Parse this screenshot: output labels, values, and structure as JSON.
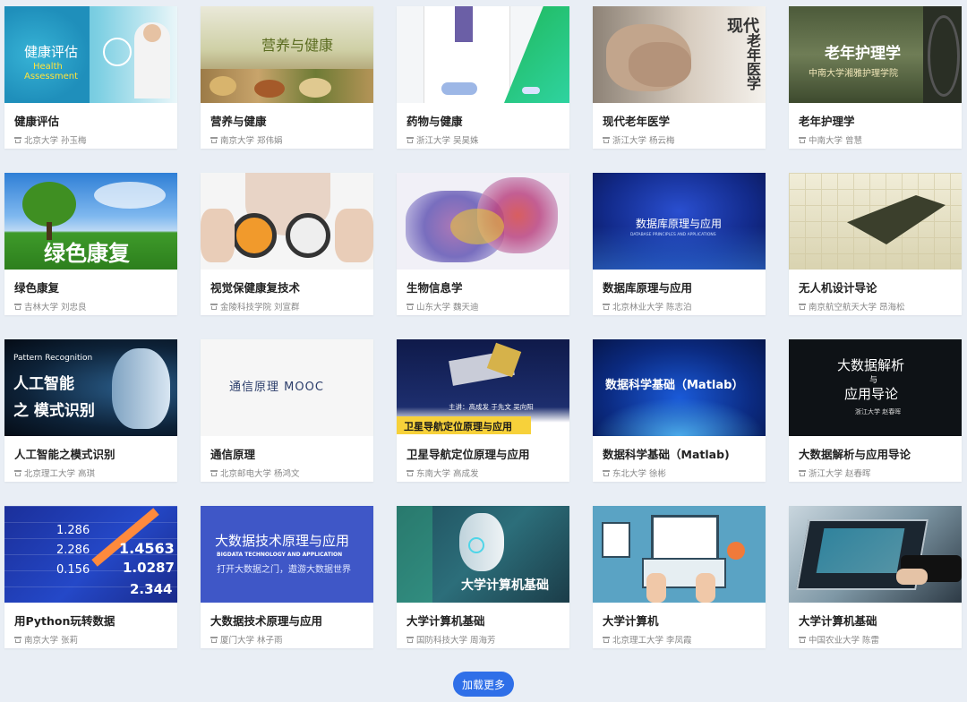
{
  "courses": [
    {
      "title": "健康评估",
      "school": "北京大学",
      "teacher": "孙玉梅",
      "cover_texts": [
        "健康评估",
        "Health",
        "Assessment"
      ]
    },
    {
      "title": "营养与健康",
      "school": "南京大学",
      "teacher": "郑伟娟",
      "cover_texts": [
        "营养与健康"
      ]
    },
    {
      "title": "药物与健康",
      "school": "浙江大学",
      "teacher": "吴昊姝",
      "cover_texts": []
    },
    {
      "title": "现代老年医学",
      "school": "浙江大学",
      "teacher": "杨云梅",
      "cover_texts": [
        "现代",
        "老年医学"
      ]
    },
    {
      "title": "老年护理学",
      "school": "中南大学",
      "teacher": "曾慧",
      "cover_texts": [
        "老年护理学",
        "中南大学湘雅护理学院"
      ]
    },
    {
      "title": "绿色康复",
      "school": "吉林大学",
      "teacher": "刘忠良",
      "cover_texts": [
        "绿色康复"
      ]
    },
    {
      "title": "视觉保健康复技术",
      "school": "金陵科技学院",
      "teacher": "刘宣群",
      "cover_texts": []
    },
    {
      "title": "生物信息学",
      "school": "山东大学",
      "teacher": "魏天迪",
      "cover_texts": []
    },
    {
      "title": "数据库原理与应用",
      "school": "北京林业大学",
      "teacher": "陈志泊",
      "cover_texts": [
        "数据库原理与应用",
        "DATABASE PRINCIPLES AND APPLICATIONS"
      ]
    },
    {
      "title": "无人机设计导论",
      "school": "南京航空航天大学",
      "teacher": "昂海松",
      "cover_texts": []
    },
    {
      "title": "人工智能之模式识别",
      "school": "北京理工大学",
      "teacher": "高琪",
      "cover_texts": [
        "Pattern Recognition",
        "人工智能",
        "之 模式识别"
      ]
    },
    {
      "title": "通信原理",
      "school": "北京邮电大学",
      "teacher": "杨鸿文",
      "cover_texts": [
        "通信原理 MOOC"
      ]
    },
    {
      "title": "卫星导航定位原理与应用",
      "school": "东南大学",
      "teacher": "高成发",
      "cover_texts": [
        "主讲：高成发 于先文 吴向阳",
        "卫星导航定位原理与应用"
      ]
    },
    {
      "title": "数据科学基础（Matlab)",
      "school": "东北大学",
      "teacher": "徐彬",
      "cover_texts": [
        "数据科学基础（Matlab）"
      ]
    },
    {
      "title": "大数据解析与应用导论",
      "school": "浙江大学",
      "teacher": "赵春晖",
      "cover_texts": [
        "大数据解析",
        "与",
        "应用导论",
        "浙江大学 赵春晖"
      ]
    },
    {
      "title": "用Python玩转数据",
      "school": "南京大学",
      "teacher": "张莉",
      "cover_texts": [
        "1.286",
        "2.286",
        "0.156",
        "1.4563",
        "1.0287",
        "2.344"
      ]
    },
    {
      "title": "大数据技术原理与应用",
      "school": "厦门大学",
      "teacher": "林子雨",
      "cover_texts": [
        "大数据技术原理与应用",
        "BIGDATA TECHNOLOGY AND APPLICATION",
        "打开大数据之门，遨游大数据世界"
      ]
    },
    {
      "title": "大学计算机基础",
      "school": "国防科技大学",
      "teacher": "周海芳",
      "cover_texts": [
        "大学计算机基础"
      ]
    },
    {
      "title": "大学计算机",
      "school": "北京理工大学",
      "teacher": "李凤霞",
      "cover_texts": []
    },
    {
      "title": "大学计算机基础",
      "school": "中国农业大学",
      "teacher": "陈雷",
      "cover_texts": []
    }
  ],
  "load_more_label": "加载更多"
}
